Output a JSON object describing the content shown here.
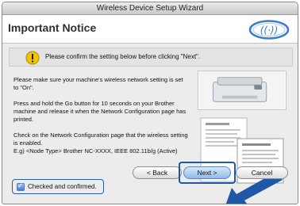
{
  "window": {
    "title": "Wireless Device Setup Wizard"
  },
  "header": {
    "title": "Important Notice"
  },
  "notice": {
    "text": "Please confirm the setting below before clicking \"Next\"."
  },
  "instructions": {
    "p1": "Please make sure your machine's wireless network setting is set to \"On\".",
    "p2": "Press and hold the Go button for 10 seconds on your Brother machine and release it when the Network Configuration page has printed.",
    "p3_line1": "Check on the Network Configuration page that the wireless setting is enabled.",
    "p3_line2": "E.g) <Node Type> Brother NC-XXXX, IEEE 802.11b/g (Active)"
  },
  "checkbox": {
    "label": "Checked and confirmed.",
    "checked": true
  },
  "buttons": {
    "back": "< Back",
    "next": "Next >",
    "cancel": "Cancel"
  },
  "colors": {
    "highlight": "#1e58a6",
    "warning": "#f2c400"
  }
}
